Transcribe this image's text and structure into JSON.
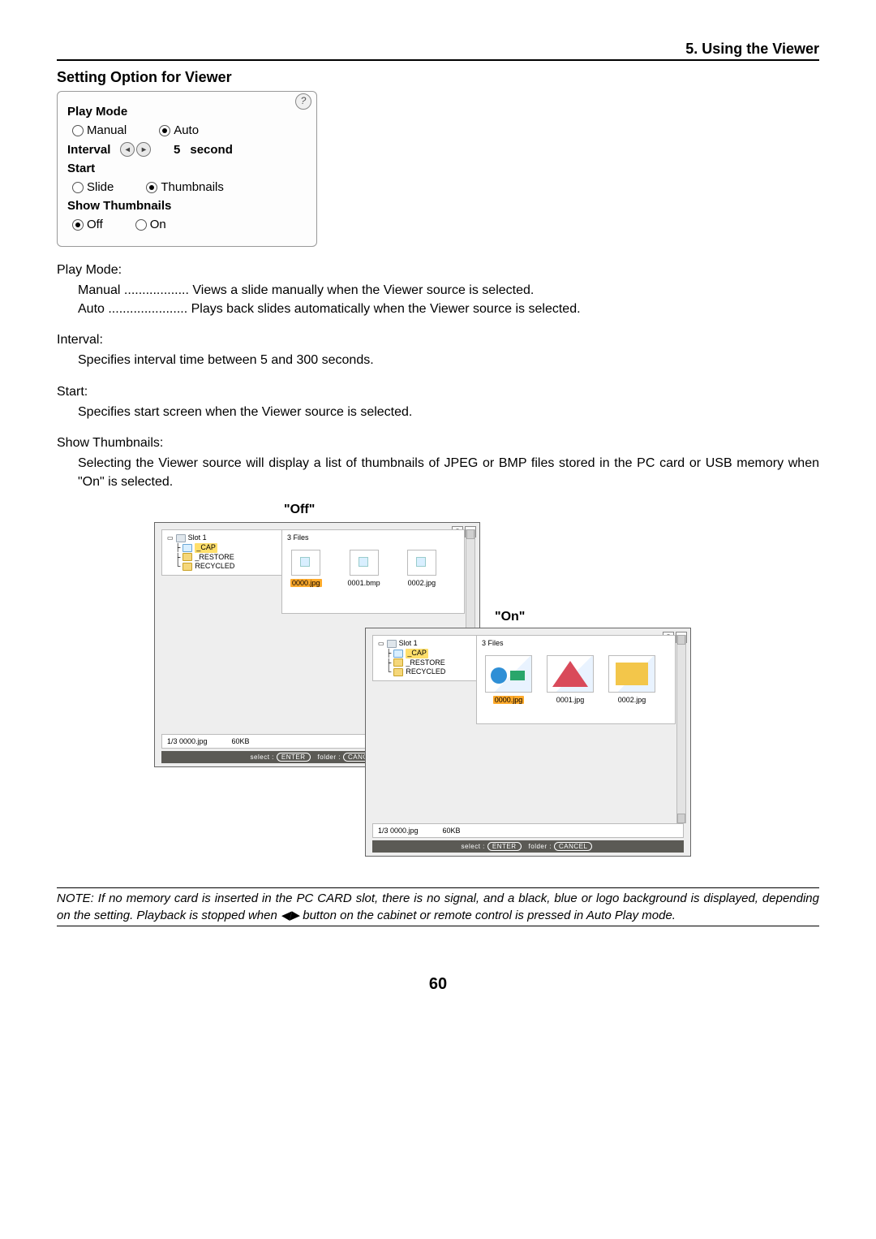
{
  "chapter": "5. Using the Viewer",
  "section": "Setting Option for Viewer",
  "dialog": {
    "play_mode_label": "Play Mode",
    "play_mode": {
      "manual": "Manual",
      "auto": "Auto"
    },
    "interval_label": "Interval",
    "interval_value": "5",
    "interval_unit": "second",
    "start_label": "Start",
    "start": {
      "slide": "Slide",
      "thumbnails": "Thumbnails"
    },
    "show_thumb_label": "Show Thumbnails",
    "show_thumb": {
      "off": "Off",
      "on": "On"
    }
  },
  "defs": {
    "play_mode_h": "Play Mode:",
    "pm_manual": "Manual .................. Views a slide manually when the Viewer source is selected.",
    "pm_auto": "Auto ...................... Plays back slides automatically when the Viewer source is selected.",
    "interval_h": "Interval:",
    "interval_t": "Specifies interval time between 5 and 300 seconds.",
    "start_h": "Start:",
    "start_t": "Specifies start screen when the Viewer source is selected.",
    "thumb_h": "Show Thumbnails:",
    "thumb_t": "Selecting the Viewer source will display a list of thumbnails of JPEG or BMP files stored in the PC card or USB memory when \"On\" is selected."
  },
  "captions": {
    "off": "\"Off\"",
    "on": "\"On\""
  },
  "tree": {
    "slot": "Slot 1",
    "cap": "_CAP",
    "restore": "_RESTORE",
    "recycled": "RECYCLED"
  },
  "thumbs_off": {
    "count": "3 Files",
    "f0": "0000.jpg",
    "f1": "0001.bmp",
    "f2": "0002.jpg"
  },
  "thumbs_on": {
    "count": "3 Files",
    "f0": "0000.jpg",
    "f1": "0001.jpg",
    "f2": "0002.jpg"
  },
  "status": {
    "left": "1/3  0000.jpg",
    "right": "60KB"
  },
  "footer": {
    "select": "select :",
    "enter": "ENTER",
    "folder": "folder :",
    "cancel": "CANCEL"
  },
  "note": "NOTE: If no memory card is inserted in the PC CARD slot, there is no signal, and a black, blue or logo background is displayed, depending on the setting. Playback is stopped when ◀▶ button on the cabinet or remote control is pressed in Auto Play mode.",
  "page": "60"
}
